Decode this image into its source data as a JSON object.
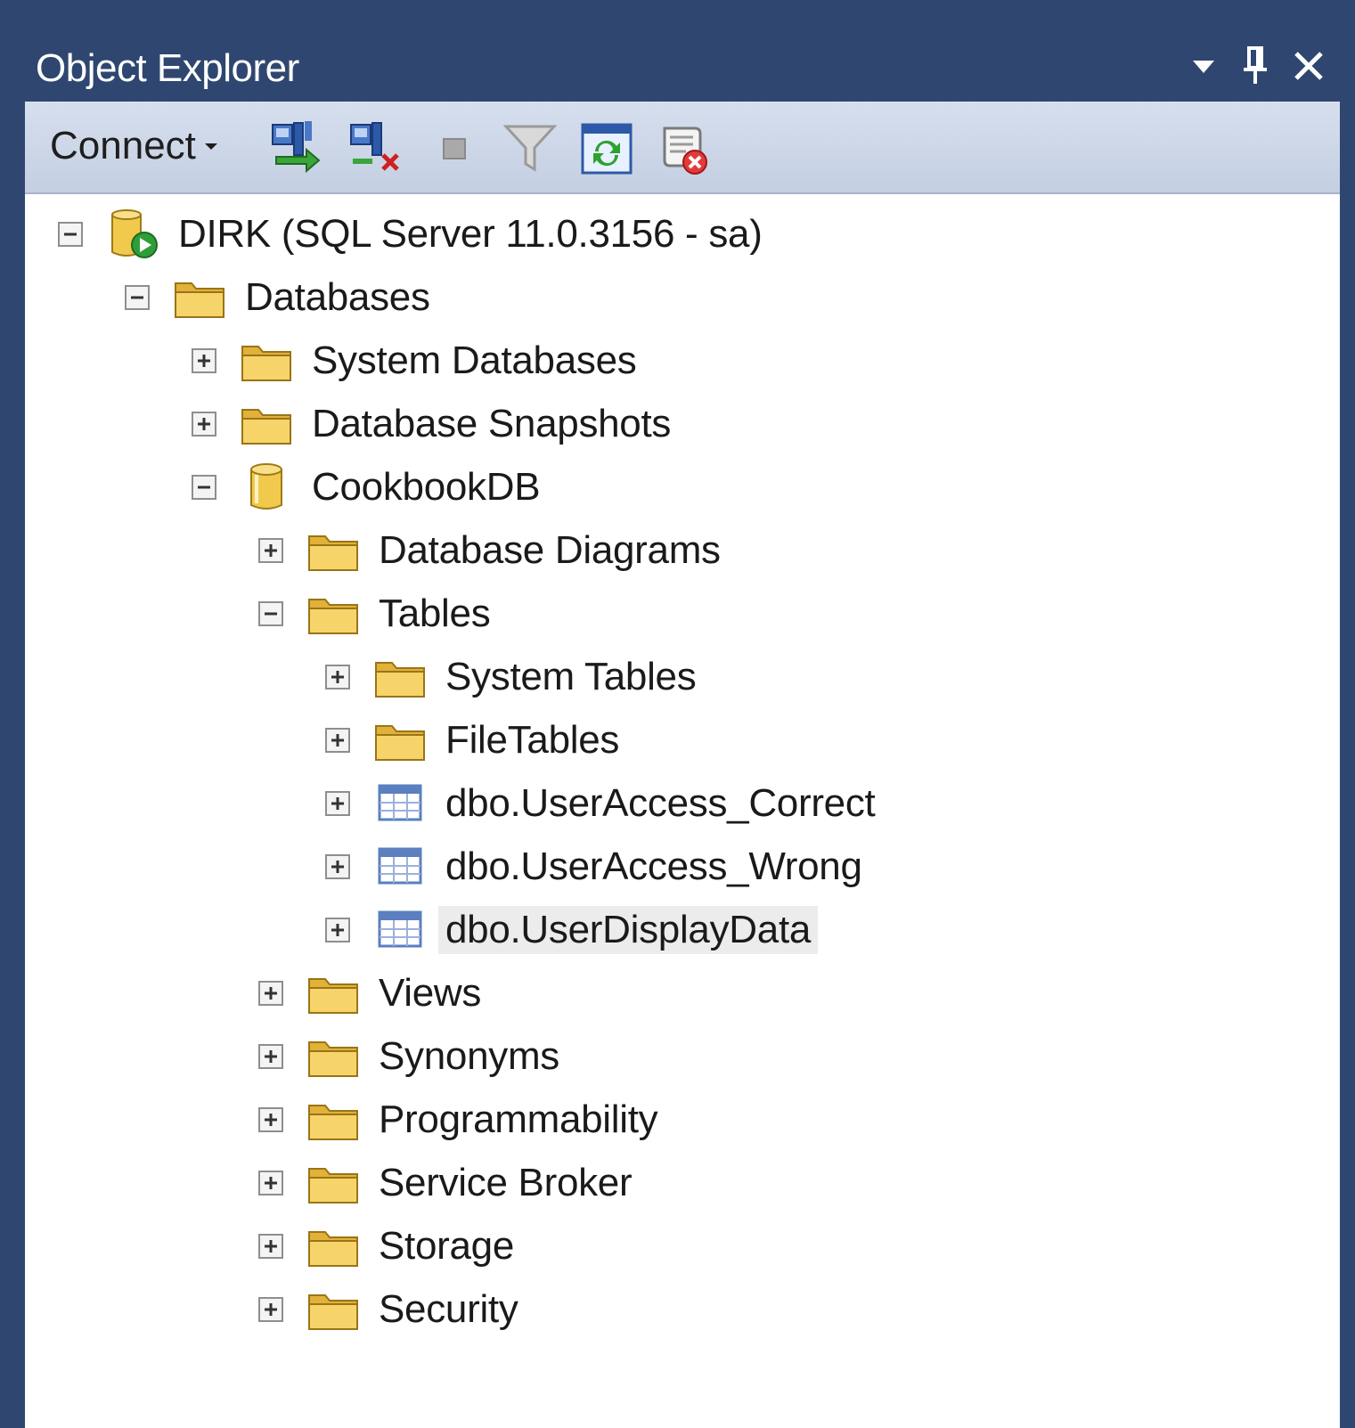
{
  "panel": {
    "title": "Object Explorer",
    "controls": [
      "dropdown-arrow-icon",
      "pin-icon",
      "close-icon"
    ]
  },
  "toolbar": {
    "connect_label": "Connect",
    "buttons": [
      "connect-object-explorer-icon",
      "disconnect-icon",
      "stop-icon",
      "filter-icon",
      "refresh-icon",
      "script-delete-icon"
    ]
  },
  "tree": [
    {
      "label": "DIRK  (SQL Server 11.0.3156 - sa)",
      "level": 0,
      "state": "expanded",
      "icon": "server-icon"
    },
    {
      "label": "Databases",
      "level": 1,
      "state": "expanded",
      "icon": "folder-icon"
    },
    {
      "label": "System Databases",
      "level": 2,
      "state": "collapsed",
      "icon": "folder-icon"
    },
    {
      "label": "Database Snapshots",
      "level": 2,
      "state": "collapsed",
      "icon": "folder-icon"
    },
    {
      "label": "CookbookDB",
      "level": 2,
      "state": "expanded",
      "icon": "database-icon"
    },
    {
      "label": "Database Diagrams",
      "level": 3,
      "state": "collapsed",
      "icon": "folder-icon"
    },
    {
      "label": "Tables",
      "level": 3,
      "state": "expanded",
      "icon": "folder-icon"
    },
    {
      "label": "System Tables",
      "level": 4,
      "state": "collapsed",
      "icon": "folder-icon"
    },
    {
      "label": "FileTables",
      "level": 4,
      "state": "collapsed",
      "icon": "folder-icon"
    },
    {
      "label": "dbo.UserAccess_Correct",
      "level": 4,
      "state": "collapsed",
      "icon": "table-icon"
    },
    {
      "label": "dbo.UserAccess_Wrong",
      "level": 4,
      "state": "collapsed",
      "icon": "table-icon"
    },
    {
      "label": "dbo.UserDisplayData",
      "level": 4,
      "state": "collapsed",
      "icon": "table-icon",
      "selected": true
    },
    {
      "label": "Views",
      "level": 3,
      "state": "collapsed",
      "icon": "folder-icon"
    },
    {
      "label": "Synonyms",
      "level": 3,
      "state": "collapsed",
      "icon": "folder-icon"
    },
    {
      "label": "Programmability",
      "level": 3,
      "state": "collapsed",
      "icon": "folder-icon"
    },
    {
      "label": "Service Broker",
      "level": 3,
      "state": "collapsed",
      "icon": "folder-icon"
    },
    {
      "label": "Storage",
      "level": 3,
      "state": "collapsed",
      "icon": "folder-icon"
    },
    {
      "label": "Security",
      "level": 3,
      "state": "collapsed",
      "icon": "folder-icon"
    }
  ],
  "colors": {
    "title_bar": "#2f4770",
    "toolbar": "#cdd7e8",
    "folder": "#f2c94c",
    "selection": "#ececec"
  }
}
